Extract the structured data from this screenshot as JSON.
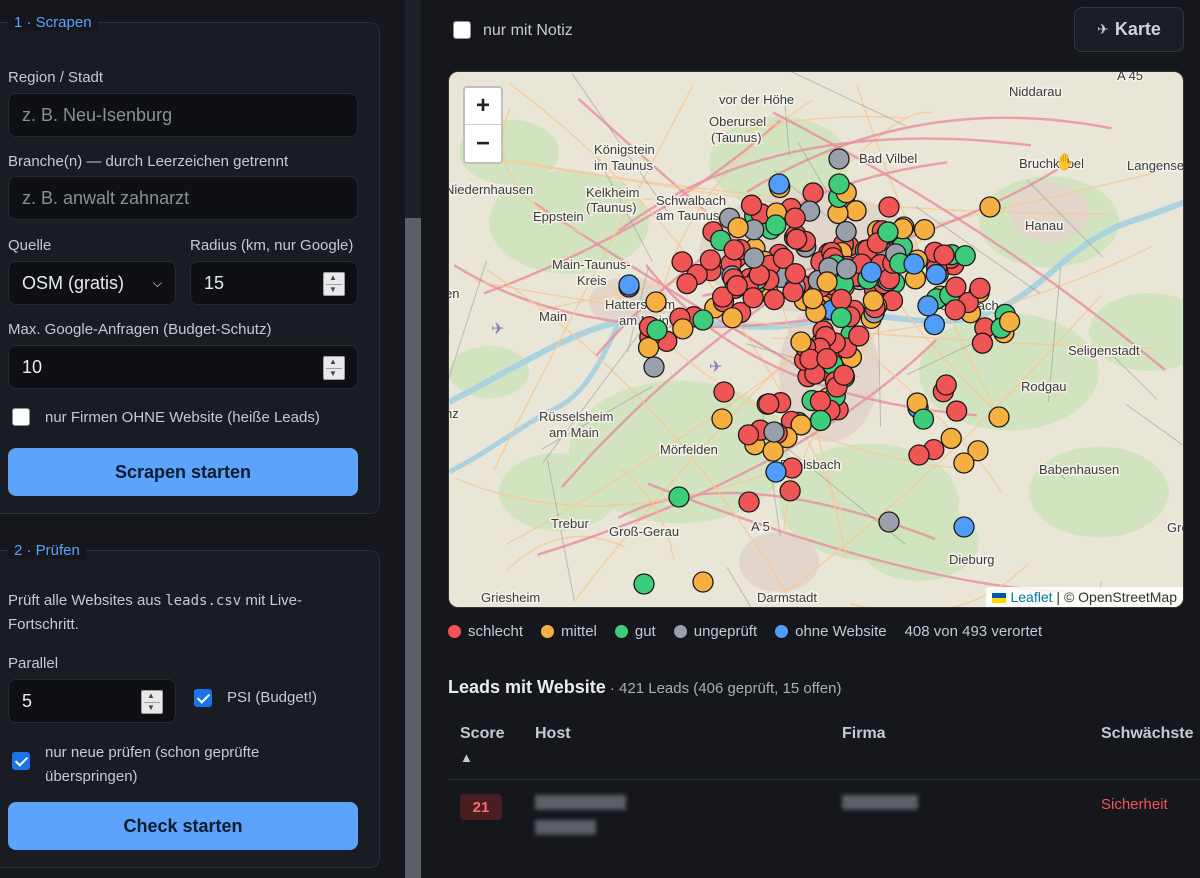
{
  "scrape": {
    "title": "1 · Scrapen",
    "region_label": "Region / Stadt",
    "region_placeholder": "z. B. Neu-Isenburg",
    "branches_label": "Branche(n) — durch Leerzeichen getrennt",
    "branches_placeholder": "z. B. anwalt zahnarzt",
    "source_label": "Quelle",
    "source_value": "OSM (gratis)",
    "radius_label": "Radius (km, nur Google)",
    "radius_value": "15",
    "max_label": "Max. Google-Anfragen (Budget-Schutz)",
    "max_value": "10",
    "no_website_label": "nur Firmen OHNE Website (heiße Leads)",
    "no_website_checked": false,
    "start_button": "Scrapen starten"
  },
  "check": {
    "title": "2 · Prüfen",
    "desc_pre": "Prüft alle Websites aus ",
    "desc_code": "leads.csv",
    "desc_post": " mit Live-",
    "desc_line2": "Fortschritt.",
    "parallel_label": "Parallel",
    "parallel_value": "5",
    "psi_label": "PSI (Budget!)",
    "psi_checked": true,
    "only_new_line1": "nur neue prüfen (schon geprüfte",
    "only_new_line2": "überspringen)",
    "only_new_checked": true,
    "start_button": "Check starten"
  },
  "toolbar": {
    "note_filter_label": "nur mit Notiz",
    "map_button": "Karte"
  },
  "map": {
    "places": [
      "Niddarau",
      "vor der Höhe",
      "Oberursel",
      "(Taunus)",
      "Königstein",
      "im Taunus",
      "Bad Vilbel",
      "Bruchköbel",
      "Langensel",
      "Niedernhausen",
      "Schwalbach",
      "am Taunus",
      "Kelkheim",
      "(Taunus)",
      "Eppstein",
      "Hanau",
      "Main-Taunus-",
      "Kreis",
      "Hattersheim",
      "am Main",
      "Offenbach",
      "Seligenstadt",
      "Rüsselsheim",
      "am Main",
      "Rodgau",
      "Mörfelden",
      "Langen",
      "Egelsbach",
      "Babenhausen",
      "Trebur",
      "Groß-Gerau",
      "Dieburg",
      "Darmstadt",
      "Griesheim",
      "Groß",
      "A 5",
      "A 45",
      "Main",
      "nz",
      "en"
    ],
    "zoom_in": "+",
    "zoom_out": "−",
    "attribution_link": "Leaflet",
    "attribution_text": "| © OpenStreetMap"
  },
  "legend": {
    "items": [
      {
        "label": "schlecht",
        "color": "#f05555"
      },
      {
        "label": "mittel",
        "color": "#f5b041"
      },
      {
        "label": "gut",
        "color": "#3dcc7a"
      },
      {
        "label": "ungeprüft",
        "color": "#9aa0ab"
      },
      {
        "label": "ohne Website",
        "color": "#4f9cf9"
      }
    ],
    "summary": "408 von 493 verortet"
  },
  "leads": {
    "title": "Leads mit Website",
    "subtitle": " · 421 Leads (406 geprüft, 15 offen)",
    "columns": [
      "Score",
      "Host",
      "Firma",
      "Schwächste"
    ],
    "sort_indicator": "▲",
    "rows": [
      {
        "score": "21",
        "host": "████████████",
        "host2": "████████",
        "firma": "██████████",
        "weakest": "Sicherheit"
      }
    ]
  },
  "icons": {
    "map_button_icon": "map-icon",
    "cursor": "hand-cursor-icon"
  },
  "colors": {
    "accent": "#5aa2ff",
    "button": "#5ba3fb",
    "bad": "#f05555"
  }
}
